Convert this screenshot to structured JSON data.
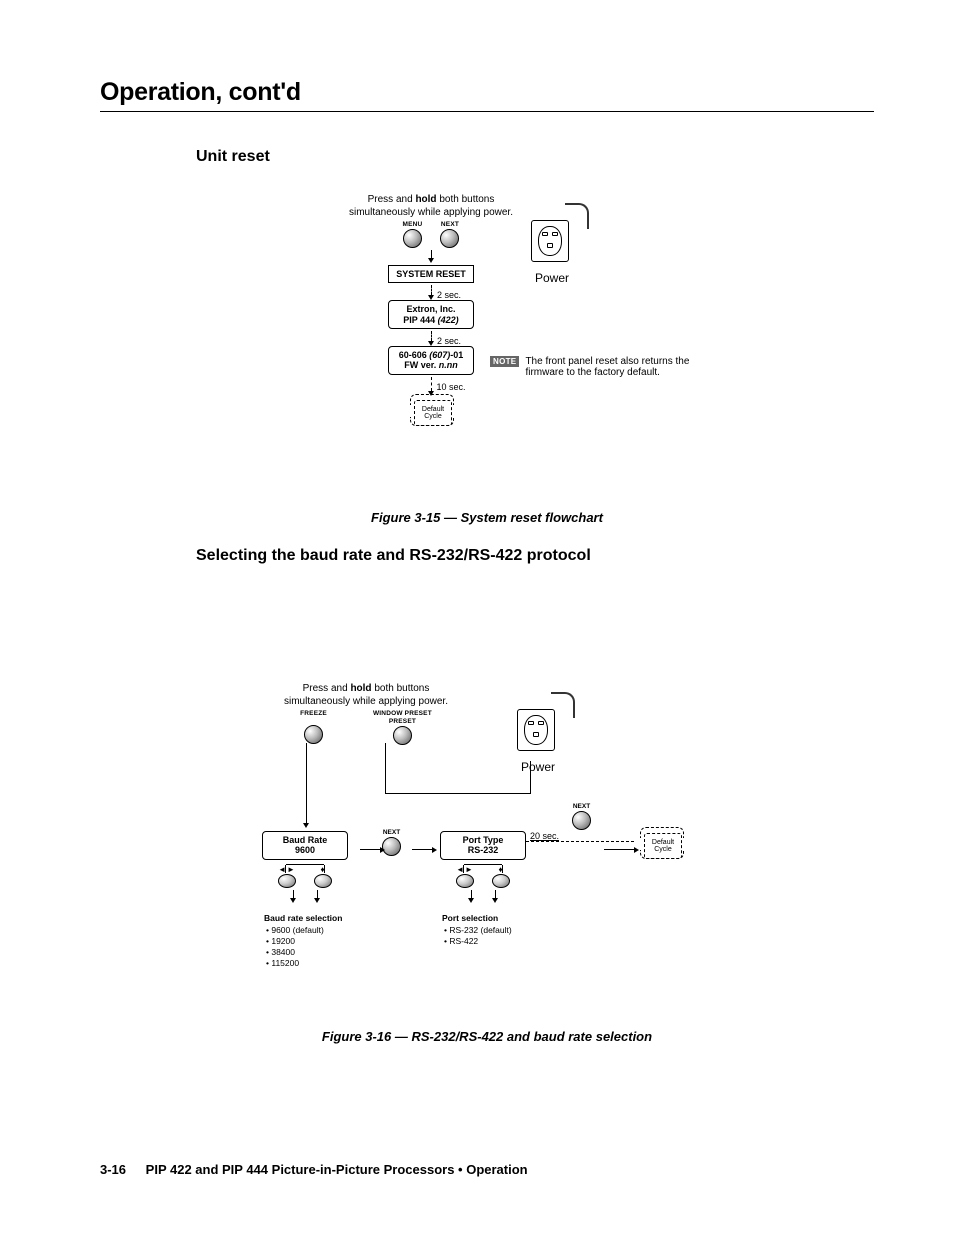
{
  "chapter_title": "Operation, cont'd",
  "section1": {
    "heading": "Unit reset"
  },
  "fig15": {
    "instr_pre": "Press and ",
    "instr_bold": "hold",
    "instr_post": " both buttons\nsimultaneously while applying power.",
    "btn_menu": "MENU",
    "btn_next": "NEXT",
    "box_system_reset": "SYSTEM RESET",
    "t1": "2 sec.",
    "box_extron_l1": "Extron, Inc.",
    "box_extron_l2a": "PIP 444 ",
    "box_extron_l2b": "(422)",
    "t2": "2 sec.",
    "box_fw_l1a": "60-606 ",
    "box_fw_l1b": "(607)",
    "box_fw_l1c": "-01",
    "box_fw_l2a": "FW ver. ",
    "box_fw_l2b": "n.nn",
    "t3": "10 sec.",
    "default": "Default\nCycle",
    "power": "Power",
    "note_badge": "NOTE",
    "note_text": "The front panel reset also returns the firmware to the factory default.",
    "caption": "Figure 3-15 — System reset flowchart"
  },
  "section2": {
    "heading": "Selecting the baud rate and RS-232/RS-422 protocol"
  },
  "fig16": {
    "instr_pre": "Press and ",
    "instr_bold": "hold",
    "instr_post": " both buttons\nsimultaneously while applying power.",
    "btn_freeze": "FREEZE",
    "btn_window_l1": "WINDOW PRESET",
    "btn_window_l2": "PRESET",
    "power": "Power",
    "next": "NEXT",
    "baud_box_l1": "Baud Rate",
    "baud_box_l2": "9600",
    "port_box_l1": "Port Type",
    "port_box_l2": "RS-232",
    "dash_lbl": "20 sec.",
    "default": "Default\nCycle",
    "baud_list_hd": "Baud rate selection",
    "baud_list": [
      "9600 (default)",
      "19200",
      "38400",
      "115200"
    ],
    "port_list_hd": "Port selection",
    "port_list": [
      "RS-232 (default)",
      "RS-422"
    ],
    "caption": "Figure 3-16 — RS-232/RS-422 and baud rate selection"
  },
  "footer": {
    "page": "3-16",
    "text": "PIP 422 and PIP 444 Picture-in-Picture Processors • Operation"
  }
}
